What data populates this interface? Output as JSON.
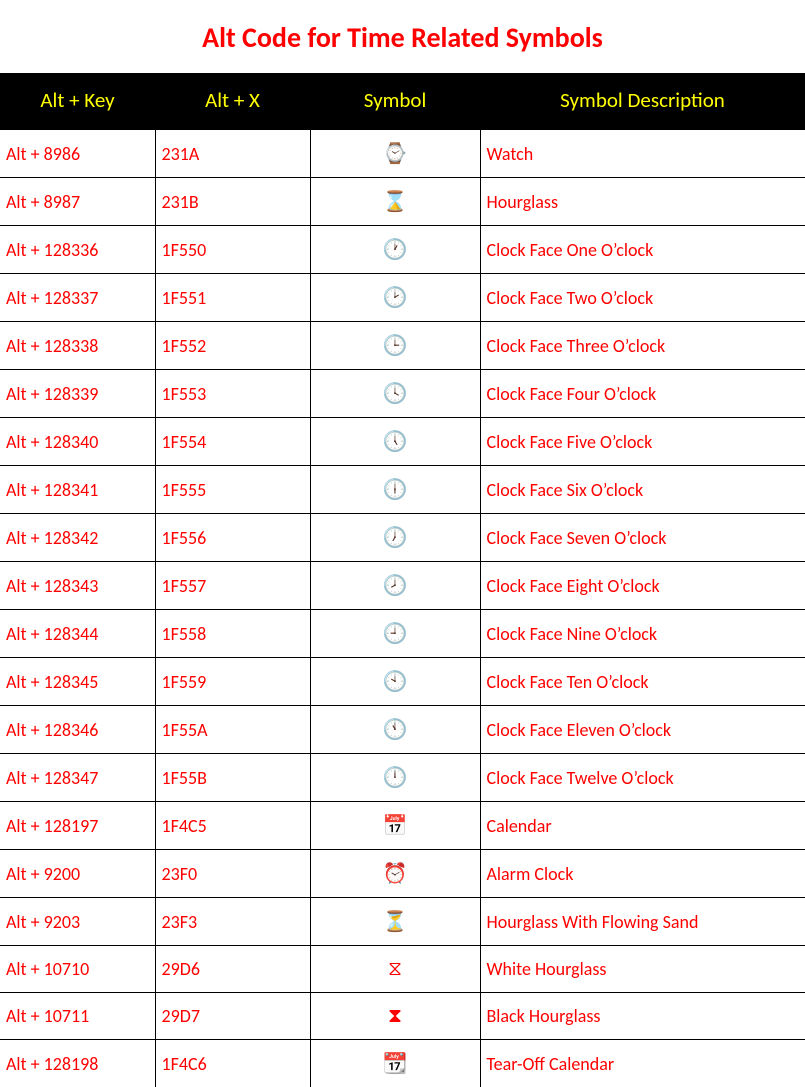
{
  "title": "Alt Code for Time Related Symbols",
  "headers": {
    "altkey": "Alt + Key",
    "altx": "Alt + X",
    "symbol": "Symbol",
    "desc": "Symbol Description"
  },
  "rows": [
    {
      "altkey": "Alt + 8986",
      "altx": "231A",
      "symbol": "⌚",
      "desc": "Watch"
    },
    {
      "altkey": "Alt + 8987",
      "altx": "231B",
      "symbol": "⌛",
      "desc": "Hourglass"
    },
    {
      "altkey": "Alt + 128336",
      "altx": "1F550",
      "symbol": "🕐",
      "desc": "Clock Face One O’clock"
    },
    {
      "altkey": "Alt + 128337",
      "altx": "1F551",
      "symbol": "🕑",
      "desc": "Clock Face Two O’clock"
    },
    {
      "altkey": "Alt + 128338",
      "altx": "1F552",
      "symbol": "🕒",
      "desc": "Clock Face Three O’clock"
    },
    {
      "altkey": "Alt + 128339",
      "altx": "1F553",
      "symbol": "🕓",
      "desc": "Clock Face Four O’clock"
    },
    {
      "altkey": "Alt + 128340",
      "altx": "1F554",
      "symbol": "🕔",
      "desc": "Clock Face Five O’clock"
    },
    {
      "altkey": "Alt + 128341",
      "altx": "1F555",
      "symbol": "🕕",
      "desc": "Clock Face Six O’clock"
    },
    {
      "altkey": "Alt + 128342",
      "altx": "1F556",
      "symbol": "🕖",
      "desc": "Clock Face Seven O’clock"
    },
    {
      "altkey": "Alt + 128343",
      "altx": "1F557",
      "symbol": "🕗",
      "desc": "Clock Face Eight O’clock"
    },
    {
      "altkey": "Alt + 128344",
      "altx": "1F558",
      "symbol": "🕘",
      "desc": "Clock Face Nine O’clock"
    },
    {
      "altkey": "Alt + 128345",
      "altx": "1F559",
      "symbol": "🕙",
      "desc": "Clock Face Ten O’clock"
    },
    {
      "altkey": "Alt + 128346",
      "altx": "1F55A",
      "symbol": "🕚",
      "desc": "Clock Face Eleven O’clock"
    },
    {
      "altkey": "Alt + 128347",
      "altx": "1F55B",
      "symbol": "🕛",
      "desc": "Clock Face Twelve O’clock"
    },
    {
      "altkey": "Alt + 128197",
      "altx": "1F4C5",
      "symbol": "📅",
      "desc": "Calendar"
    },
    {
      "altkey": "Alt + 9200",
      "altx": "23F0",
      "symbol": "⏰",
      "desc": "Alarm Clock"
    },
    {
      "altkey": "Alt + 9203",
      "altx": "23F3",
      "symbol": "⏳",
      "desc": "Hourglass With Flowing Sand"
    },
    {
      "altkey": "Alt + 10710",
      "altx": "29D6",
      "symbol": "⧖",
      "desc": "White Hourglass"
    },
    {
      "altkey": "Alt + 10711",
      "altx": "29D7",
      "symbol": "⧗",
      "desc": "Black Hourglass"
    },
    {
      "altkey": "Alt + 128198",
      "altx": "1F4C6",
      "symbol": "📆",
      "desc": "Tear-Off Calendar"
    }
  ]
}
